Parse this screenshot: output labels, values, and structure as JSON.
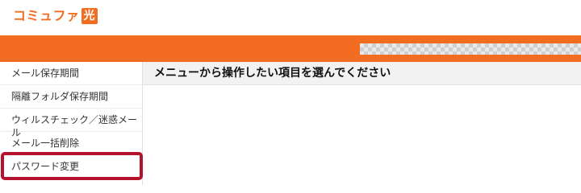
{
  "brand": {
    "logo_text": "コミュファ",
    "logo_mark": "光"
  },
  "header": {
    "account_masked": ""
  },
  "sidebar": {
    "items": [
      {
        "label": "メール保存期間"
      },
      {
        "label": "隔離フォルダ保存期間"
      },
      {
        "label": "ウィルスチェック／迷惑メール"
      },
      {
        "label": "メール一括削除"
      },
      {
        "label": "パスワード変更",
        "highlighted": true
      }
    ]
  },
  "main": {
    "title": "メニューから操作したい項目を選んでください"
  },
  "colors": {
    "brand": "#f26c21",
    "highlight_border": "#b5122e"
  }
}
